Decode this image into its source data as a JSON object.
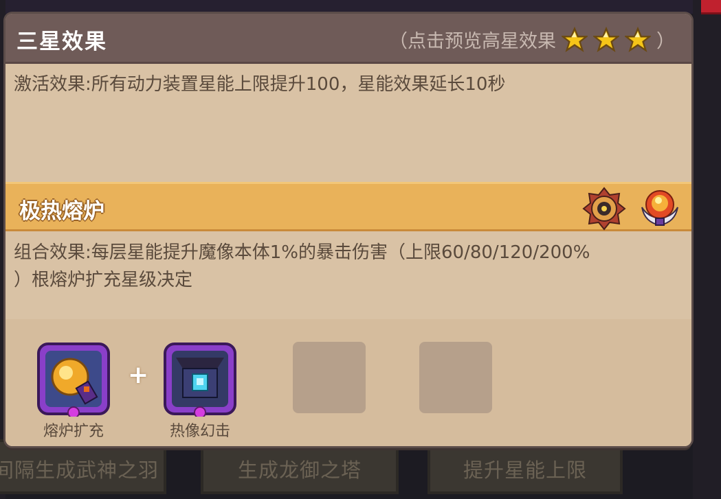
{
  "panel": {
    "title": "三星效果",
    "preview_hint_open": "（点击预览高星效果",
    "preview_hint_close": "）",
    "star_count": 3,
    "activation_text": "激活效果:所有动力装置星能上限提升100，星能效果延长10秒"
  },
  "combo": {
    "title": "极热熔炉",
    "icons": [
      "mechanical-gear-core-icon",
      "flame-orb-horns-icon"
    ],
    "effect_line1": "组合效果:每层星能提升魔像本体1%的暴击伤害（上限60/80/120/200%",
    "effect_line2": "）根熔炉扩充星级决定"
  },
  "slots": [
    {
      "label": "熔炉扩充",
      "icon": "furnace-orb-icon"
    },
    {
      "label": "热像幻击",
      "icon": "turret-crystal-icon"
    }
  ],
  "plus_symbol": "+",
  "background_buttons": [
    "间隔生成武神之羽",
    "生成龙御之塔",
    "提升星能上限"
  ],
  "colors": {
    "panel_bg": "#d9c2a5",
    "title_bar": "#6f5b58",
    "combo_bar": "#e9b25a",
    "text": "#5a4a3c",
    "star": "#f5c518"
  }
}
